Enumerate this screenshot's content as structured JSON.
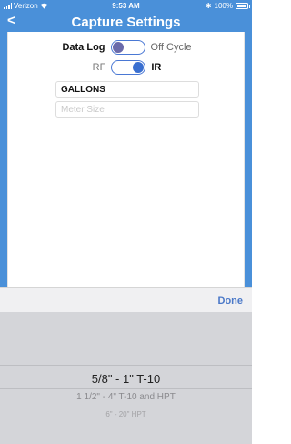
{
  "status_bar": {
    "carrier": "Verizon",
    "time": "9:53 AM",
    "battery": "100%",
    "bluetooth": "✱"
  },
  "nav": {
    "back": "<",
    "title": "Capture Settings"
  },
  "settings": {
    "mode_left": "Data Log",
    "mode_right": "Off Cycle",
    "comm_left": "RF",
    "comm_right": "IR",
    "units_value": "GALLONS",
    "meter_size_placeholder": "Meter Size"
  },
  "toolbar": {
    "done": "Done"
  },
  "picker": {
    "options": [
      "5/8\" - 1\" T-10",
      "1 1/2\" - 4\" T-10 and HPT",
      "6\" - 20\" HPT"
    ]
  },
  "colors": {
    "accent": "#4a90d9",
    "done_text": "#4a78c8",
    "picker_bg": "#d4d5d9"
  }
}
